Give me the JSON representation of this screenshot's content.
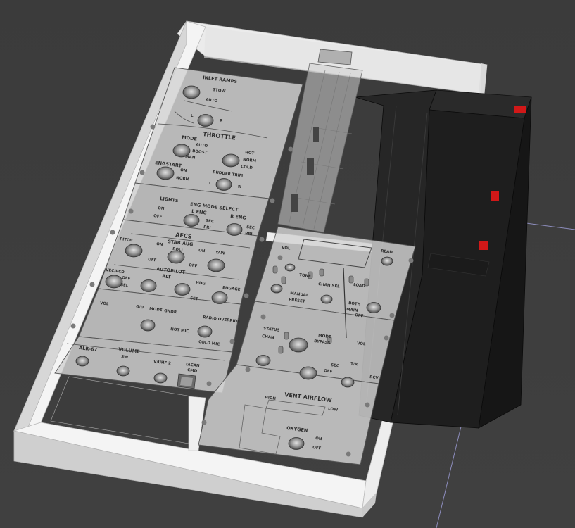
{
  "colors": {
    "background": "#3f3f3f",
    "frame": "#f2f2f2",
    "panel_glass": "#d2d2d2",
    "battery_body": "#1b1b1b",
    "battery_terminal": "#d11818",
    "axis_line": "#8d8dbd"
  },
  "panel_labels": {
    "inlet_ramps": "INLET RAMPS",
    "stow": "STOW",
    "auto_1": "AUTO",
    "l_1": "L",
    "r_1": "R",
    "throttle": "THROTTLE",
    "mode": "MODE",
    "auto_2": "AUTO",
    "boost": "BOOST",
    "man": "MAN",
    "hot": "HOT",
    "norm": "NORM",
    "cold": "COLD",
    "engstart": "ENGSTART",
    "on_1": "ON",
    "norm_2": "NORM",
    "rudder_trim": "RUDDER TRIM",
    "l_2": "L",
    "r_2": "R",
    "lights": "LIGHTS",
    "on_2": "ON",
    "off_1": "OFF",
    "eng_mode_select": "ENG MODE SELECT",
    "l_eng": "L ENG",
    "r_eng": "R ENG",
    "sec_1": "SEC",
    "pri_1": "PRI",
    "sec_2": "SEC",
    "pri_2": "PRI",
    "afcs": "AFCS",
    "stab_aug": "STAB AUG",
    "pitch": "PITCH",
    "roll": "ROLL",
    "yaw": "YAW",
    "on_3": "ON",
    "on_4": "ON",
    "off_2": "OFF",
    "off_3": "OFF",
    "autopilot": "AUTOPILOT",
    "alt": "ALT",
    "vec_pcd": "VEC/PCD",
    "off_4": "OFF",
    "sel": "SEL",
    "hdg": "HDG",
    "set": "SET",
    "engage": "ENGAGE",
    "vol_1": "VOL",
    "g_u": "G/U",
    "mode_3": "MODE",
    "gnd": "GNDR",
    "radio_override": "RADIO OVERRIDE",
    "hot_mic": "HOT MIC",
    "cold_mic": "COLD MIC",
    "alr_67": "ALR-67",
    "volume": "VOLUME",
    "sw": "SW",
    "v_uhf_2": "V/UHF 2",
    "tacan": "TACAN",
    "cmd": "CMD",
    "tone": "TONE",
    "chan_sel": "CHAN SEL",
    "load": "LOAD",
    "read": "READ",
    "manual": "MANUAL",
    "preset": "PRESET",
    "both": "BOTH",
    "main": "MAIN",
    "off_5": "OFF",
    "status": "STATUS",
    "chan": "CHAN",
    "mode_4": "MODE",
    "bypass": "BYPASS",
    "vol_2": "VOL",
    "sec_3": "SEC",
    "off_6": "OFF",
    "t_r": "T/R",
    "rcv": "RCV",
    "vent_airflow": "VENT AIRFLOW",
    "high": "HIGH",
    "low": "LOW",
    "oxygen": "OXYGEN",
    "on_5": "ON",
    "off_7": "OFF",
    "vol_3": "VOL"
  }
}
